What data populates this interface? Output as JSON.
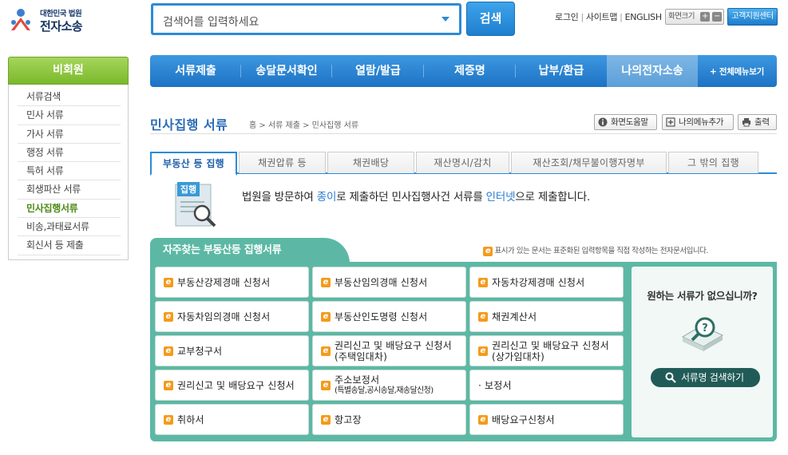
{
  "header": {
    "logo_small": "대한민국 법원",
    "logo_big": "전자소송",
    "search_placeholder": "검색어를 입력하세요",
    "search_button": "검색",
    "util_login": "로그인",
    "util_sitemap": "사이트맵",
    "util_english": "ENGLISH",
    "font_size_label": "화면크기",
    "font_plus": "+",
    "font_minus": "−",
    "customer_center": "고객지원센터"
  },
  "nav": {
    "items": [
      "서류제출",
      "송달문서확인",
      "열람/발급",
      "제증명",
      "납부/환급",
      "나의전자소송"
    ],
    "selected_index": 5,
    "all_menu": "+ 전체메뉴보기"
  },
  "sidebar": {
    "header": "비회원",
    "items": [
      "서류검색",
      "민사 서류",
      "가사 서류",
      "행정 서류",
      "특허 서류",
      "회생파산 서류",
      "민사집행서류",
      "비송,과태료서류",
      "회신서 등 제출"
    ],
    "selected_index": 6
  },
  "page": {
    "title": "민사집행 서류",
    "breadcrumb": "홈 > 서류 제출 > 민사집행 서류",
    "btn_help": "화면도움말",
    "btn_mymenu": "나의메뉴추가",
    "btn_print": "출력"
  },
  "tabs": {
    "items": [
      "부동산 등 집행",
      "채권압류 등",
      "채권배당",
      "재산명시/감치",
      "재산조회/채무불이행자명부",
      "그 밖의 집행"
    ],
    "selected_index": 0
  },
  "intro": {
    "icon_label": "집행",
    "text_1": "법원을 방문하여 ",
    "text_hl_1": "종이",
    "text_2": "로 제출하던 민사집행사건 서류를 ",
    "text_hl_2": "인터넷",
    "text_3": "으로 제출합니다."
  },
  "favorites": {
    "tab_label": "자주찾는 부동산등 집행서류",
    "legend": "표시가 있는 문서는 표준화된 입력항목을 직접 작성하는 전자문서입니다.",
    "forms": [
      {
        "label": "부동산강제경매 신청서",
        "sub": "",
        "electronic": true
      },
      {
        "label": "부동산임의경매 신청서",
        "sub": "",
        "electronic": true
      },
      {
        "label": "자동차강제경매 신청서",
        "sub": "",
        "electronic": true
      },
      {
        "label": "자동차임의경매 신청서",
        "sub": "",
        "electronic": true
      },
      {
        "label": "부동산인도명령 신청서",
        "sub": "",
        "electronic": true
      },
      {
        "label": "채권계산서",
        "sub": "",
        "electronic": true
      },
      {
        "label": "교부청구서",
        "sub": "",
        "electronic": true
      },
      {
        "label": "권리신고 및 배당요구 신청서",
        "sub": "(주택임대차)",
        "electronic": true
      },
      {
        "label": "권리신고 및 배당요구 신청서",
        "sub": "(상가임대차)",
        "electronic": true
      },
      {
        "label": "권리신고 및 배당요구 신청서",
        "sub": "",
        "electronic": true
      },
      {
        "label": "주소보정서",
        "sub": "(특별송달,공시송달,재송달신청)",
        "electronic": true
      },
      {
        "label": "· 보정서",
        "sub": "",
        "electronic": false
      },
      {
        "label": "취하서",
        "sub": "",
        "electronic": true
      },
      {
        "label": "항고장",
        "sub": "",
        "electronic": true
      },
      {
        "label": "배당요구신청서",
        "sub": "",
        "electronic": true
      }
    ],
    "side_question": "원하는 서류가 없으십니까?",
    "side_button": "서류명 검색하기"
  },
  "colors": {
    "nav_blue": "#1d72c4",
    "sidebar_green": "#7bb82c",
    "panel_teal": "#5cb8a4",
    "e_icon_orange": "#f39b1c",
    "side_button_dark": "#215b57"
  }
}
